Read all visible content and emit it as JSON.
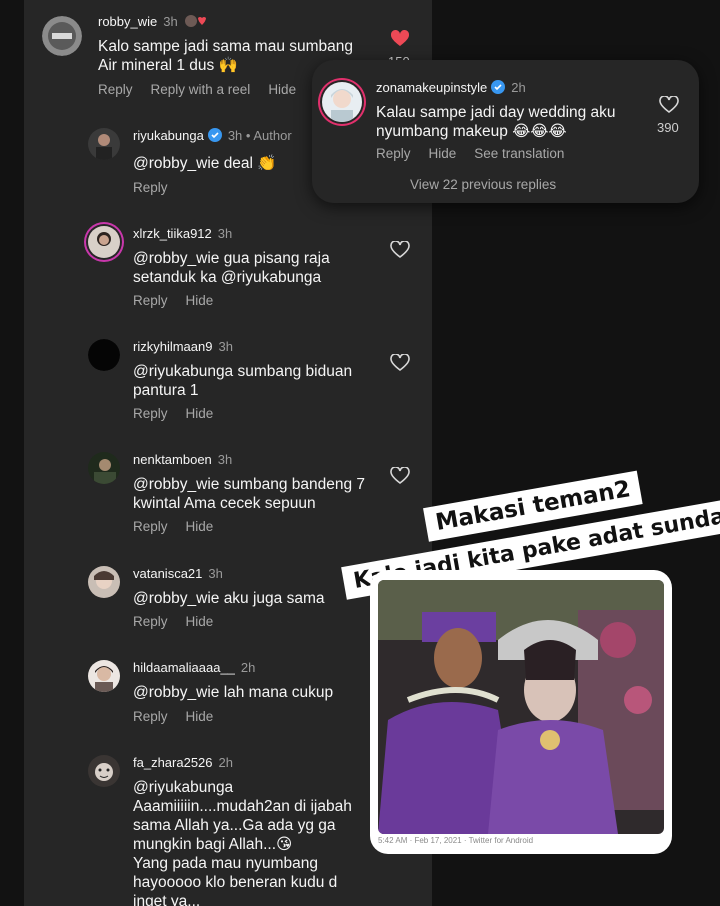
{
  "comments": [
    {
      "username": "robby_wie",
      "time": "3h",
      "lines": [
        "Kalo sampe jadi sama mau sumbang",
        "Air mineral 1 dus 🙌"
      ],
      "actions": [
        "Reply",
        "Reply with a reel",
        "Hide"
      ],
      "likes": "150"
    },
    {
      "username": "riyukabunga",
      "time": "3h",
      "author_label": "• Author",
      "lines": [
        "@robby_wie deal 👏"
      ],
      "actions": [
        "Reply"
      ]
    },
    {
      "username": "xlrzk_tiika912",
      "time": "3h",
      "lines": [
        "@robby_wie gua pisang raja",
        "setanduk ka @riyukabunga"
      ],
      "actions": [
        "Reply",
        "Hide"
      ]
    },
    {
      "username": "rizkyhilmaan9",
      "time": "3h",
      "lines": [
        "@riyukabunga sumbang biduan",
        "pantura 1"
      ],
      "actions": [
        "Reply",
        "Hide"
      ]
    },
    {
      "username": "nenktamboen",
      "time": "3h",
      "lines": [
        "@robby_wie sumbang bandeng 7",
        "kwintal  Ama cecek sepuun"
      ],
      "actions": [
        "Reply",
        "Hide"
      ]
    },
    {
      "username": "vatanisca21",
      "time": "3h",
      "lines": [
        "@robby_wie aku juga sama"
      ],
      "actions": [
        "Reply",
        "Hide"
      ]
    },
    {
      "username": "hildaamaliaaaa__",
      "time": "2h",
      "lines": [
        "@robby_wie lah mana cukup"
      ],
      "actions": [
        "Reply",
        "Hide"
      ]
    },
    {
      "username": "fa_zhara2526",
      "time": "2h",
      "lines": [
        "@riyukabunga",
        "Aaamiiiiin....mudah2an di ijabah",
        "sama Allah ya...Ga ada yg ga",
        "mungkin bagi Allah...😘",
        "Yang pada mau nyumbang",
        "hayooooo klo beneran kudu d",
        "inget ya..."
      ]
    }
  ],
  "popup": {
    "username": "zonamakeupinstyle",
    "time": "2h",
    "lines": [
      "Kalau sampe jadi day wedding aku",
      "nyumbang makeup 😂😂😂"
    ],
    "actions": [
      "Reply",
      "Hide",
      "See translation"
    ],
    "likes": "390",
    "view_replies": "View 22 previous replies"
  },
  "sticker": {
    "line1": "Makasi teman2",
    "line2": "Kalo jadi kita pake adat sunda 🙏"
  },
  "tweet_card": {
    "meta": "5:42 AM · Feb 17, 2021 · Twitter for Android"
  },
  "colors": {
    "panel_bg": "#262626",
    "page_bg": "#121212",
    "like_red": "#ed4956",
    "verified_blue": "#3897f0",
    "muted_text": "#a8a8a8"
  }
}
